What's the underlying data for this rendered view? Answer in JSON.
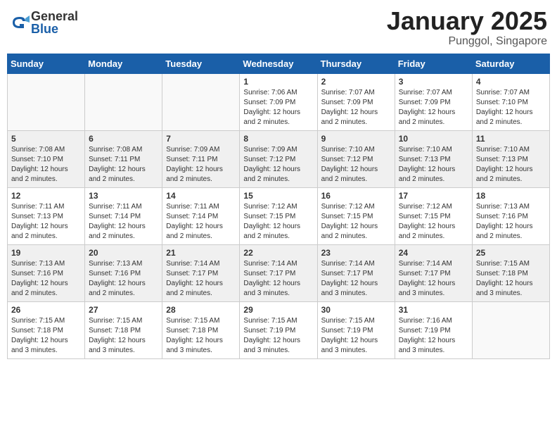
{
  "header": {
    "logo": {
      "general": "General",
      "blue": "Blue"
    },
    "title": "January 2025",
    "location": "Punggol, Singapore"
  },
  "days_of_week": [
    "Sunday",
    "Monday",
    "Tuesday",
    "Wednesday",
    "Thursday",
    "Friday",
    "Saturday"
  ],
  "weeks": [
    [
      {
        "day": "",
        "sunrise": "",
        "sunset": "",
        "daylight": ""
      },
      {
        "day": "",
        "sunrise": "",
        "sunset": "",
        "daylight": ""
      },
      {
        "day": "",
        "sunrise": "",
        "sunset": "",
        "daylight": ""
      },
      {
        "day": "1",
        "sunrise": "Sunrise: 7:06 AM",
        "sunset": "Sunset: 7:09 PM",
        "daylight": "Daylight: 12 hours and 2 minutes."
      },
      {
        "day": "2",
        "sunrise": "Sunrise: 7:07 AM",
        "sunset": "Sunset: 7:09 PM",
        "daylight": "Daylight: 12 hours and 2 minutes."
      },
      {
        "day": "3",
        "sunrise": "Sunrise: 7:07 AM",
        "sunset": "Sunset: 7:09 PM",
        "daylight": "Daylight: 12 hours and 2 minutes."
      },
      {
        "day": "4",
        "sunrise": "Sunrise: 7:07 AM",
        "sunset": "Sunset: 7:10 PM",
        "daylight": "Daylight: 12 hours and 2 minutes."
      }
    ],
    [
      {
        "day": "5",
        "sunrise": "Sunrise: 7:08 AM",
        "sunset": "Sunset: 7:10 PM",
        "daylight": "Daylight: 12 hours and 2 minutes."
      },
      {
        "day": "6",
        "sunrise": "Sunrise: 7:08 AM",
        "sunset": "Sunset: 7:11 PM",
        "daylight": "Daylight: 12 hours and 2 minutes."
      },
      {
        "day": "7",
        "sunrise": "Sunrise: 7:09 AM",
        "sunset": "Sunset: 7:11 PM",
        "daylight": "Daylight: 12 hours and 2 minutes."
      },
      {
        "day": "8",
        "sunrise": "Sunrise: 7:09 AM",
        "sunset": "Sunset: 7:12 PM",
        "daylight": "Daylight: 12 hours and 2 minutes."
      },
      {
        "day": "9",
        "sunrise": "Sunrise: 7:10 AM",
        "sunset": "Sunset: 7:12 PM",
        "daylight": "Daylight: 12 hours and 2 minutes."
      },
      {
        "day": "10",
        "sunrise": "Sunrise: 7:10 AM",
        "sunset": "Sunset: 7:13 PM",
        "daylight": "Daylight: 12 hours and 2 minutes."
      },
      {
        "day": "11",
        "sunrise": "Sunrise: 7:10 AM",
        "sunset": "Sunset: 7:13 PM",
        "daylight": "Daylight: 12 hours and 2 minutes."
      }
    ],
    [
      {
        "day": "12",
        "sunrise": "Sunrise: 7:11 AM",
        "sunset": "Sunset: 7:13 PM",
        "daylight": "Daylight: 12 hours and 2 minutes."
      },
      {
        "day": "13",
        "sunrise": "Sunrise: 7:11 AM",
        "sunset": "Sunset: 7:14 PM",
        "daylight": "Daylight: 12 hours and 2 minutes."
      },
      {
        "day": "14",
        "sunrise": "Sunrise: 7:11 AM",
        "sunset": "Sunset: 7:14 PM",
        "daylight": "Daylight: 12 hours and 2 minutes."
      },
      {
        "day": "15",
        "sunrise": "Sunrise: 7:12 AM",
        "sunset": "Sunset: 7:15 PM",
        "daylight": "Daylight: 12 hours and 2 minutes."
      },
      {
        "day": "16",
        "sunrise": "Sunrise: 7:12 AM",
        "sunset": "Sunset: 7:15 PM",
        "daylight": "Daylight: 12 hours and 2 minutes."
      },
      {
        "day": "17",
        "sunrise": "Sunrise: 7:12 AM",
        "sunset": "Sunset: 7:15 PM",
        "daylight": "Daylight: 12 hours and 2 minutes."
      },
      {
        "day": "18",
        "sunrise": "Sunrise: 7:13 AM",
        "sunset": "Sunset: 7:16 PM",
        "daylight": "Daylight: 12 hours and 2 minutes."
      }
    ],
    [
      {
        "day": "19",
        "sunrise": "Sunrise: 7:13 AM",
        "sunset": "Sunset: 7:16 PM",
        "daylight": "Daylight: 12 hours and 2 minutes."
      },
      {
        "day": "20",
        "sunrise": "Sunrise: 7:13 AM",
        "sunset": "Sunset: 7:16 PM",
        "daylight": "Daylight: 12 hours and 2 minutes."
      },
      {
        "day": "21",
        "sunrise": "Sunrise: 7:14 AM",
        "sunset": "Sunset: 7:17 PM",
        "daylight": "Daylight: 12 hours and 2 minutes."
      },
      {
        "day": "22",
        "sunrise": "Sunrise: 7:14 AM",
        "sunset": "Sunset: 7:17 PM",
        "daylight": "Daylight: 12 hours and 3 minutes."
      },
      {
        "day": "23",
        "sunrise": "Sunrise: 7:14 AM",
        "sunset": "Sunset: 7:17 PM",
        "daylight": "Daylight: 12 hours and 3 minutes."
      },
      {
        "day": "24",
        "sunrise": "Sunrise: 7:14 AM",
        "sunset": "Sunset: 7:17 PM",
        "daylight": "Daylight: 12 hours and 3 minutes."
      },
      {
        "day": "25",
        "sunrise": "Sunrise: 7:15 AM",
        "sunset": "Sunset: 7:18 PM",
        "daylight": "Daylight: 12 hours and 3 minutes."
      }
    ],
    [
      {
        "day": "26",
        "sunrise": "Sunrise: 7:15 AM",
        "sunset": "Sunset: 7:18 PM",
        "daylight": "Daylight: 12 hours and 3 minutes."
      },
      {
        "day": "27",
        "sunrise": "Sunrise: 7:15 AM",
        "sunset": "Sunset: 7:18 PM",
        "daylight": "Daylight: 12 hours and 3 minutes."
      },
      {
        "day": "28",
        "sunrise": "Sunrise: 7:15 AM",
        "sunset": "Sunset: 7:18 PM",
        "daylight": "Daylight: 12 hours and 3 minutes."
      },
      {
        "day": "29",
        "sunrise": "Sunrise: 7:15 AM",
        "sunset": "Sunset: 7:19 PM",
        "daylight": "Daylight: 12 hours and 3 minutes."
      },
      {
        "day": "30",
        "sunrise": "Sunrise: 7:15 AM",
        "sunset": "Sunset: 7:19 PM",
        "daylight": "Daylight: 12 hours and 3 minutes."
      },
      {
        "day": "31",
        "sunrise": "Sunrise: 7:16 AM",
        "sunset": "Sunset: 7:19 PM",
        "daylight": "Daylight: 12 hours and 3 minutes."
      },
      {
        "day": "",
        "sunrise": "",
        "sunset": "",
        "daylight": ""
      }
    ]
  ]
}
